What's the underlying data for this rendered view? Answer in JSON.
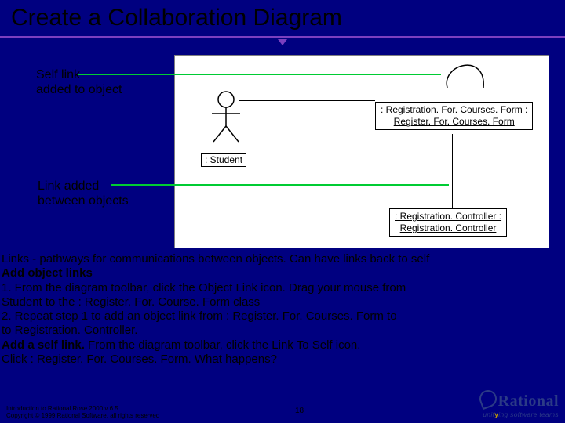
{
  "title": "Create a Collaboration Diagram",
  "callouts": {
    "self_link": "Self link\nadded to object",
    "link_added": "Link added\nbetween objects"
  },
  "diagram": {
    "student_label": ": Student",
    "registration_form": {
      "line1": ": Registration. For. Courses. Form :",
      "line2": "Register. For. Courses. Form"
    },
    "registration_controller": {
      "line1": ": Registration. Controller :",
      "line2": "Registration. Controller"
    }
  },
  "body": {
    "links_desc": "Links - pathways for communications between objects. Can have links back to self",
    "add_object_heading": "Add object links",
    "step1a": "1.   From the diagram toolbar, click the Object Link icon. Drag your mouse from",
    "step1b": " Student to the  : Register. For. Course. Form class",
    "step2a": "2. Repeat step 1 to add an object link from : Register. For. Courses. Form to",
    "step2b": " to Registration. Controller.",
    "add_self_heading": "Add a self link.",
    "add_self_rest": "  From the diagram toolbar, click the Link To Self icon.",
    "click_line": "Click : Register. For. Courses. Form. What happens?"
  },
  "footer": {
    "line1": "Introduction to Rational Rose 2000 v 6.5",
    "line2": "Copyright © 1999 Rational Software, all rights reserved",
    "page": "18",
    "brand": "Rational",
    "tagline_pre": "unif",
    "tagline_y": "y",
    "tagline_post": "ing software teams"
  }
}
